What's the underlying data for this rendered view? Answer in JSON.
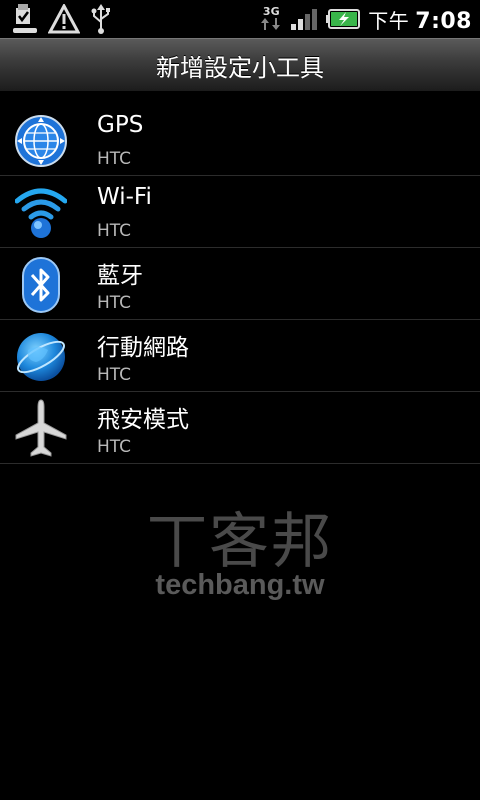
{
  "status_bar": {
    "icons_left": [
      "task-done-icon",
      "warning-icon",
      "usb-icon"
    ],
    "network_type": "3G",
    "battery_state": "charging",
    "time_prefix": "下午",
    "time": "7:08"
  },
  "header": {
    "title": "新增設定小工具"
  },
  "items": [
    {
      "label": "GPS",
      "vendor": "HTC",
      "icon": "gps-icon"
    },
    {
      "label": "Wi-Fi",
      "vendor": "HTC",
      "icon": "wifi-icon"
    },
    {
      "label": "藍牙",
      "vendor": "HTC",
      "icon": "bluetooth-icon"
    },
    {
      "label": "行動網路",
      "vendor": "HTC",
      "icon": "mobile-network-icon"
    },
    {
      "label": "飛安模式",
      "vendor": "HTC",
      "icon": "airplane-icon"
    }
  ],
  "watermark": {
    "chinese": "丅客邦",
    "url": "techbang.tw"
  },
  "colors": {
    "accent_blue": "#1e73d8",
    "background": "#000000",
    "subtext": "#b8b8b8"
  }
}
